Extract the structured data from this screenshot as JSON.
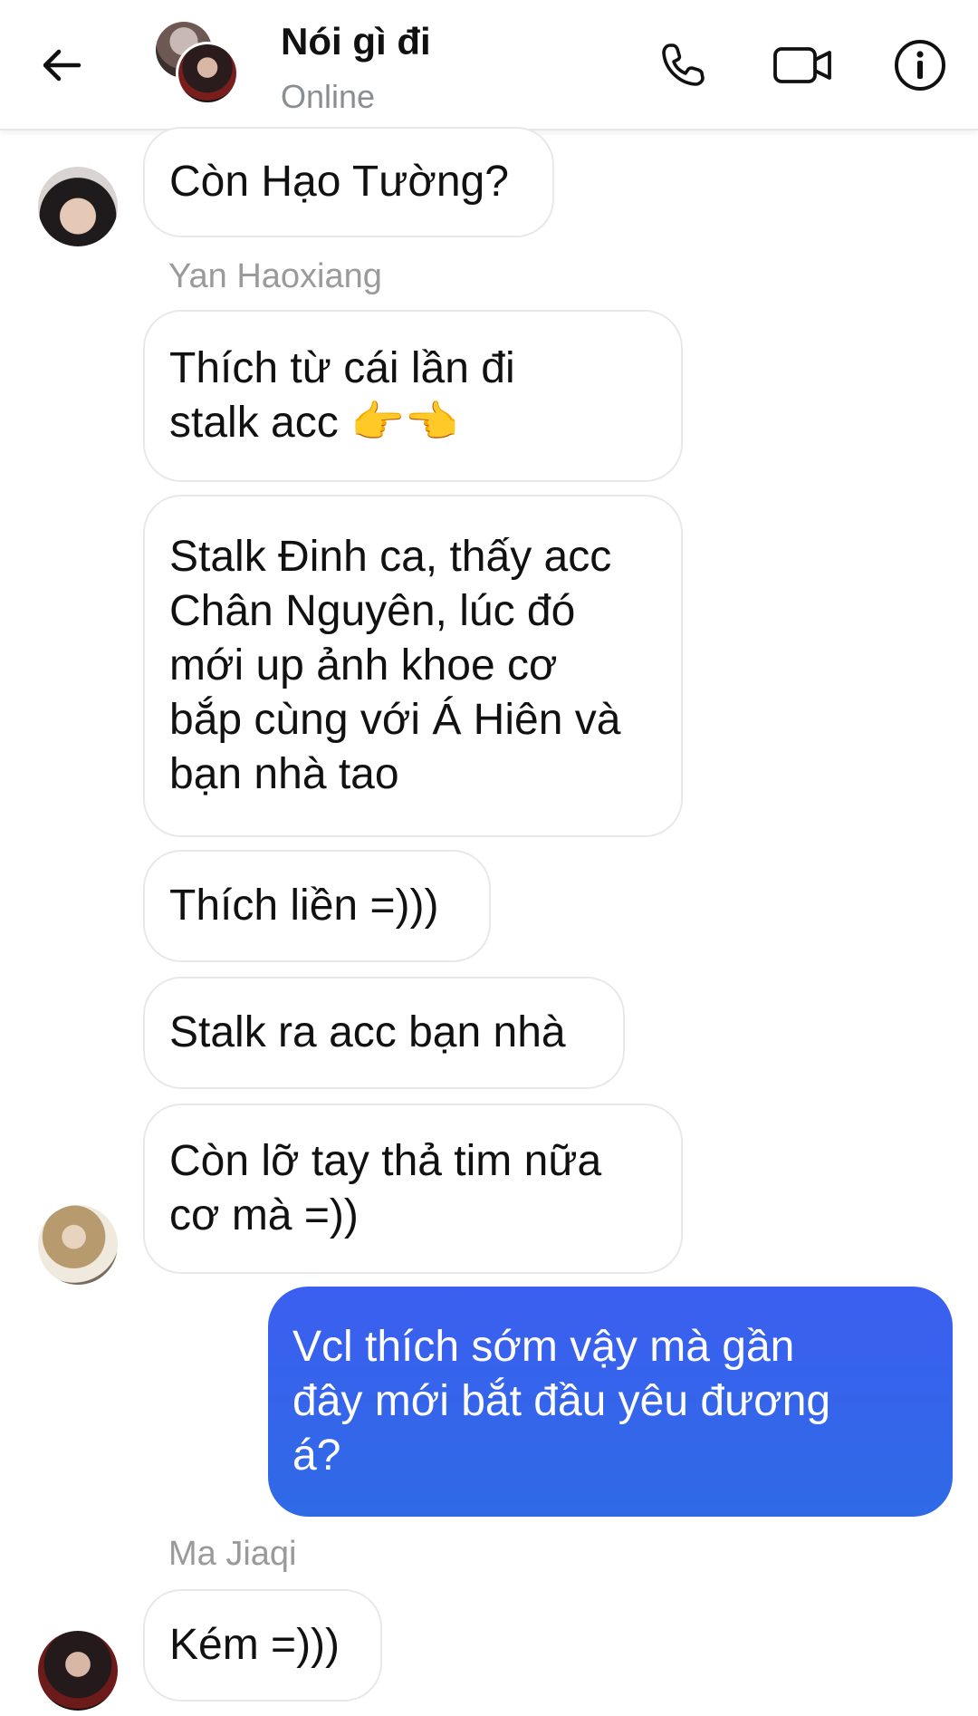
{
  "header": {
    "title": "Nói gì đi",
    "status": "Online",
    "icons": {
      "back": "arrow-left-icon",
      "call": "phone-icon",
      "video": "video-camera-icon",
      "info": "info-icon"
    }
  },
  "messages": [
    {
      "text": "Còn Hạo Tường?"
    },
    {
      "sender": "Yan Haoxiang"
    },
    {
      "text": "Thích từ cái lần đi\nstalk acc 👉👈"
    },
    {
      "text": "Stalk Đinh ca, thấy acc\nChân Nguyên, lúc đó\nmới up ảnh khoe cơ\nbắp cùng với Á Hiên và\nbạn nhà tao"
    },
    {
      "text": "Thích liền =)))"
    },
    {
      "text": "Stalk ra acc bạn nhà"
    },
    {
      "text": "Còn lỡ tay thả tim nữa\ncơ mà =))"
    },
    {
      "text": "Vcl thích sớm vậy mà gần\nđây mới bắt đầu yêu đương\ná?"
    },
    {
      "sender": "Ma Jiaqi"
    },
    {
      "text": "Kém =)))"
    }
  ],
  "colors": {
    "outgoing_bubble": "#3b5ff0",
    "incoming_bubble": "#ffffff",
    "sender_text": "#9a9a9a",
    "status_text": "#8a8d91"
  }
}
